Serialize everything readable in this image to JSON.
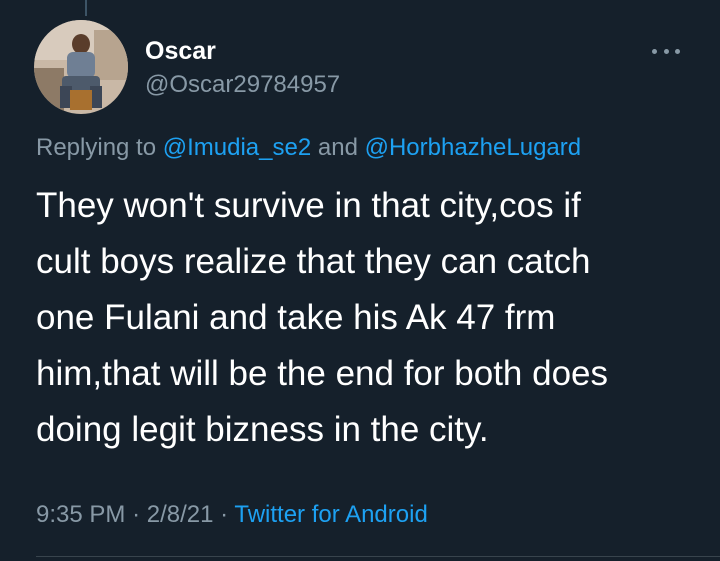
{
  "tweet": {
    "author": {
      "display_name": "Oscar",
      "handle": "@Oscar29784957"
    },
    "replying": {
      "prefix": "Replying to",
      "mention_1": "@Imudia_se2",
      "conjunction": "and",
      "mention_2": "@HorbhazheLugard"
    },
    "body_lines": [
      "They won't survive in that city,cos if",
      "cult boys realize that they can catch",
      "one Fulani and take his Ak 47 frm",
      "him,that will be the end for both does",
      "doing legit bizness in the city."
    ],
    "meta": {
      "time": "9:35 PM",
      "separator": "·",
      "date": "2/8/21",
      "source": "Twitter for Android"
    }
  },
  "icons": {
    "more": "more-options-icon"
  },
  "colors": {
    "background": "#15202b",
    "text_primary": "#ffffff",
    "text_secondary": "#8899a6",
    "accent": "#1da1f2",
    "divider": "#38444d"
  }
}
